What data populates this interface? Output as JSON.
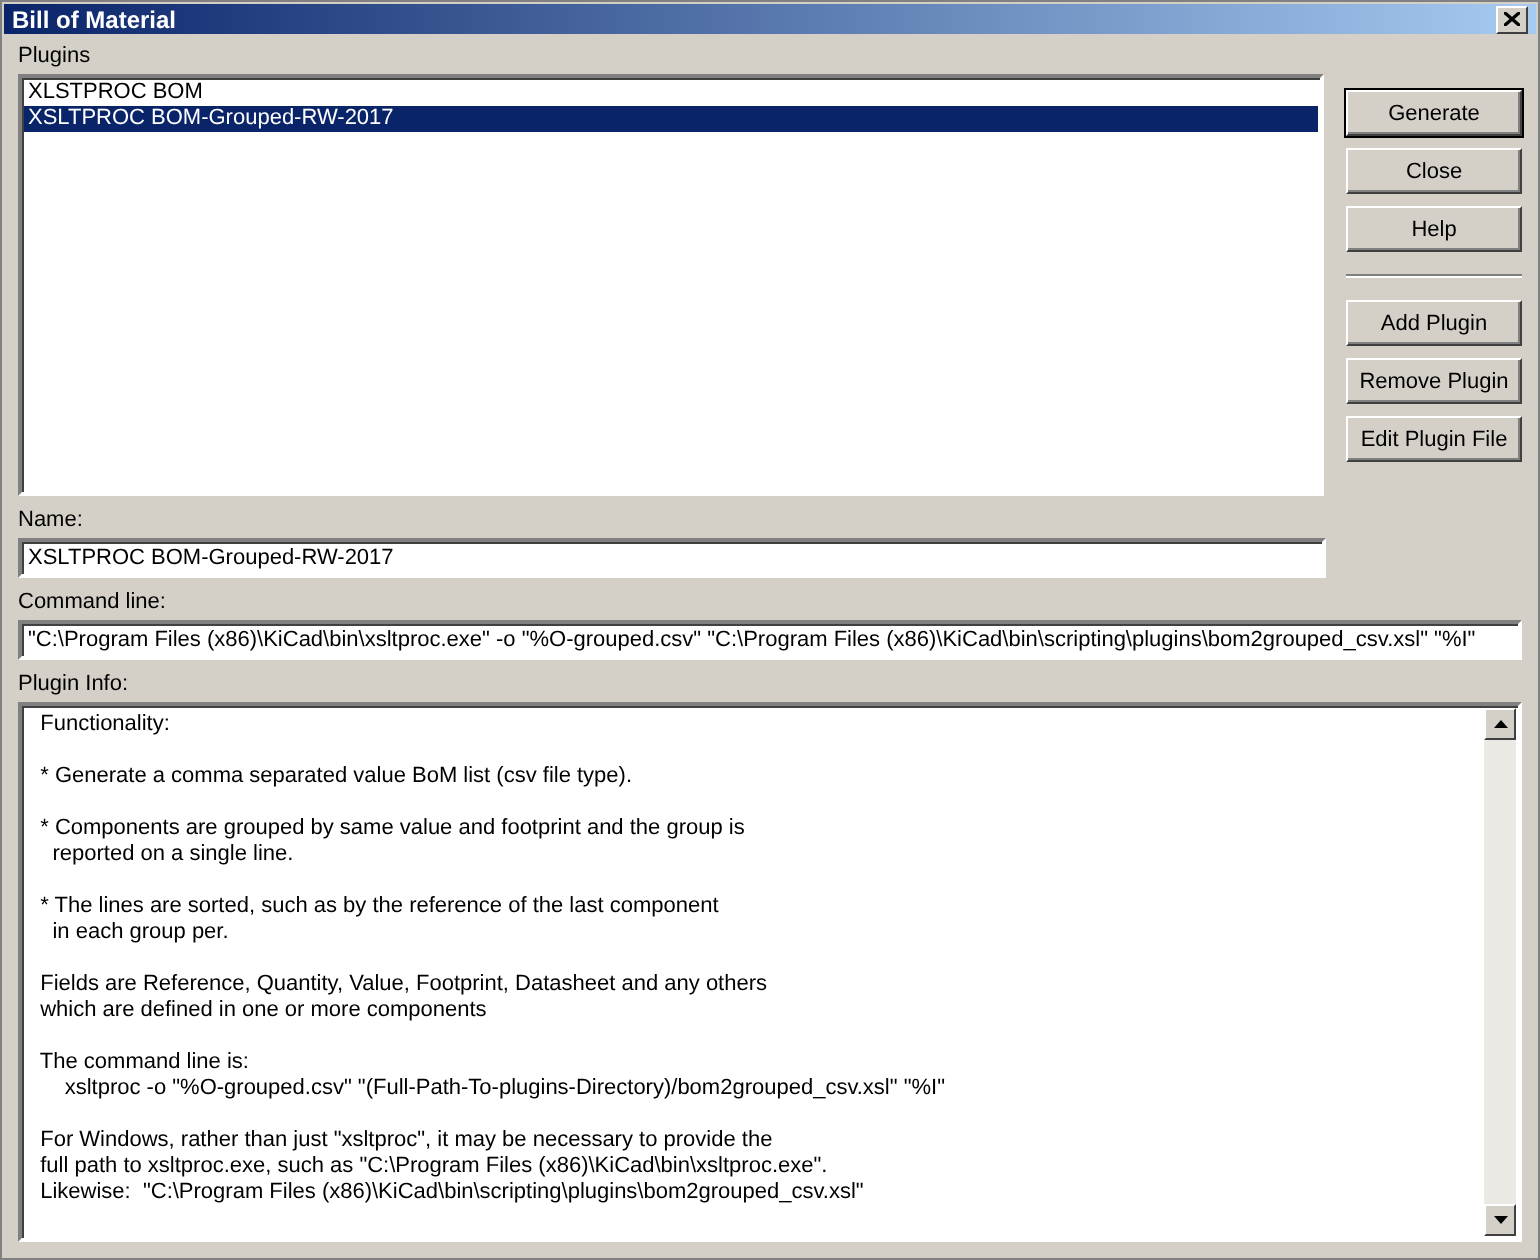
{
  "window": {
    "title": "Bill of Material"
  },
  "plugins": {
    "label": "Plugins",
    "items": [
      {
        "text": "XLSTPROC BOM",
        "selected": false
      },
      {
        "text": "XSLTPROC BOM-Grouped-RW-2017",
        "selected": true
      }
    ]
  },
  "buttons": [
    {
      "label": "Generate",
      "default": true
    },
    {
      "label": "Close",
      "default": false
    },
    {
      "label": "Help",
      "default": false
    }
  ],
  "plugin_buttons": [
    {
      "label": "Add Plugin",
      "default": false
    },
    {
      "label": "Remove Plugin",
      "default": false
    },
    {
      "label": "Edit Plugin File",
      "default": false
    }
  ],
  "name": {
    "label": "Name:",
    "value": "XSLTPROC BOM-Grouped-RW-2017"
  },
  "command_line": {
    "label": "Command line:",
    "value": "\"C:\\Program Files (x86)\\KiCad\\bin\\xsltproc.exe\" -o \"%O-grouped.csv\" \"C:\\Program Files (x86)\\KiCad\\bin\\scripting\\plugins\\bom2grouped_csv.xsl\" \"%I\""
  },
  "plugin_info": {
    "label": "Plugin Info:",
    "paragraphs": [
      "  Functionality:",
      "  * Generate a comma separated value BoM list (csv file type).",
      "  * Components are grouped by same value and footprint and the group is\n    reported on a single line.",
      "  * The lines are sorted, such as by the reference of the last component\n    in each group per.",
      "  Fields are Reference, Quantity, Value, Footprint, Datasheet and any others\n  which are defined in one or more components",
      "  The command line is:\n      xsltproc -o \"%O-grouped.csv\" \"(Full-Path-To-plugins-Directory)/bom2grouped_csv.xsl\" \"%I\"",
      "  For Windows, rather than just \"xsltproc\", it may be necessary to provide the\n  full path to xsltproc.exe, such as \"C:\\Program Files (x86)\\KiCad\\bin\\xsltproc.exe\".\n  Likewise:  \"C:\\Program Files (x86)\\KiCad\\bin\\scripting\\plugins\\bom2grouped_csv.xsl\""
    ]
  }
}
